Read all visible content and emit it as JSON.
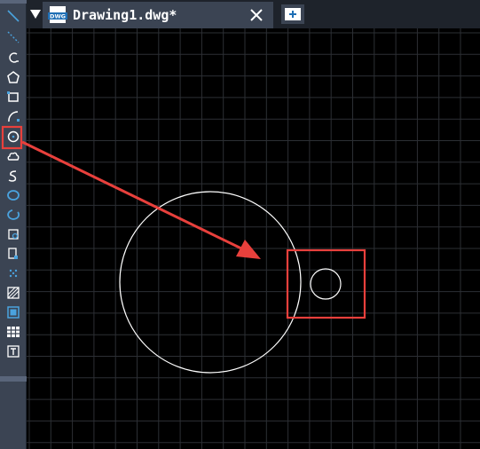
{
  "tab": {
    "title": "Drawing1.dwg*",
    "icon": "dwg-file-icon"
  },
  "toolbar": {
    "tools": [
      {
        "name": "line-icon"
      },
      {
        "name": "construction-line-icon"
      },
      {
        "name": "polyline-icon"
      },
      {
        "name": "polygon-icon"
      },
      {
        "name": "rectangle-icon"
      },
      {
        "name": "arc-icon"
      },
      {
        "name": "circle-icon",
        "selected": true
      },
      {
        "name": "revision-cloud-icon"
      },
      {
        "name": "spline-icon"
      },
      {
        "name": "ellipse-icon"
      },
      {
        "name": "ellipse-arc-icon"
      },
      {
        "name": "insert-block-icon"
      },
      {
        "name": "make-block-icon"
      },
      {
        "name": "point-icon"
      },
      {
        "name": "hatch-icon"
      },
      {
        "name": "gradient-icon"
      },
      {
        "name": "table-icon"
      },
      {
        "name": "multiline-text-icon"
      }
    ]
  },
  "colors": {
    "highlight": "#e8403c",
    "drawing": "#ffffff",
    "grid": "#2c2f34",
    "accent": "#4aa3df"
  }
}
